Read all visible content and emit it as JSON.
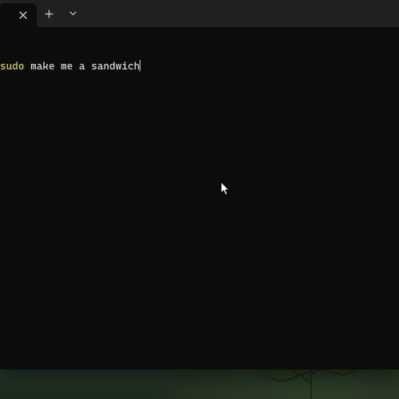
{
  "tabbar": {
    "active_tab_title": "",
    "close_icon": "close-icon",
    "new_tab_icon": "plus-icon",
    "tab_menu_icon": "chevron-down-icon"
  },
  "terminal": {
    "lines": [
      {
        "keyword": "sudo",
        "rest": " make me a sandwich"
      }
    ],
    "cursor_visible": true
  },
  "colors": {
    "title_bar": "#202020",
    "terminal_bg": "#0c0c0c",
    "keyword": "#d6c86a",
    "text": "#d9d9d9"
  }
}
